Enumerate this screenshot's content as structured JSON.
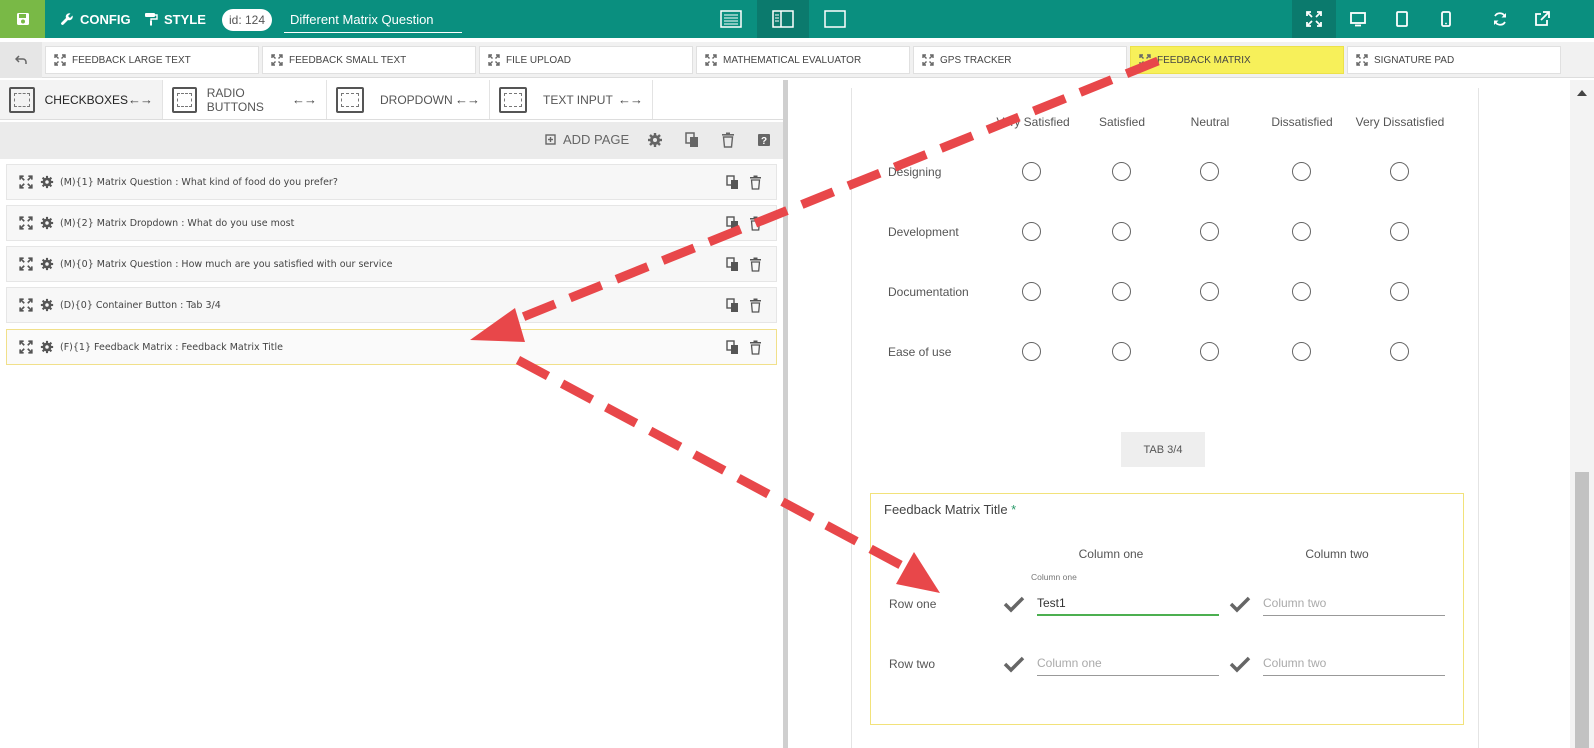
{
  "topbar": {
    "config_label": "CONFIG",
    "style_label": "STYLE",
    "id_label": "id: 124",
    "form_title": "Different Matrix Question"
  },
  "components": [
    {
      "label": "FEEDBACK LARGE TEXT"
    },
    {
      "label": "FEEDBACK SMALL TEXT"
    },
    {
      "label": "FILE UPLOAD"
    },
    {
      "label": "MATHEMATICAL EVALUATOR"
    },
    {
      "label": "GPS TRACKER"
    },
    {
      "label": "FEEDBACK MATRIX"
    },
    {
      "label": "SIGNATURE PAD"
    }
  ],
  "tabs": [
    {
      "label": "CHECKBOXES"
    },
    {
      "label": "RADIO BUTTONS"
    },
    {
      "label": "DROPDOWN"
    },
    {
      "label": "TEXT INPUT"
    }
  ],
  "actionbar": {
    "add_page": "ADD PAGE"
  },
  "items": [
    {
      "label": "(M){1} Matrix Question : What kind of food do you prefer?"
    },
    {
      "label": "(M){2} Matrix Dropdown : What do you use most"
    },
    {
      "label": "(M){0} Matrix Question : How much are you satisfied with our service"
    },
    {
      "label": "(D){0} Container Button : Tab 3/4"
    },
    {
      "label": "(F){1} Feedback Matrix : Feedback Matrix Title"
    }
  ],
  "preview": {
    "columns": [
      "Very Satisfied",
      "Satisfied",
      "Neutral",
      "Dissatisfied",
      "Very Dissatisfied"
    ],
    "rows": [
      "Designing",
      "Development",
      "Documentation",
      "Ease of use"
    ],
    "tab_button": "TAB 3/4",
    "feedback": {
      "title": "Feedback Matrix Title",
      "required_mark": "*",
      "columns": [
        "Column one",
        "Column two"
      ],
      "rows": [
        "Row one",
        "Row two"
      ],
      "float_label": "Column one",
      "value_r1c1": "Test1",
      "placeholder_r1c2": "Column two",
      "placeholder_r2c1": "Column one",
      "placeholder_r2c2": "Column two"
    }
  },
  "colors": {
    "topbar": "#0a8f7f",
    "save": "#79b946",
    "highlight": "#f7f05a",
    "arrow": "#e8474a"
  }
}
